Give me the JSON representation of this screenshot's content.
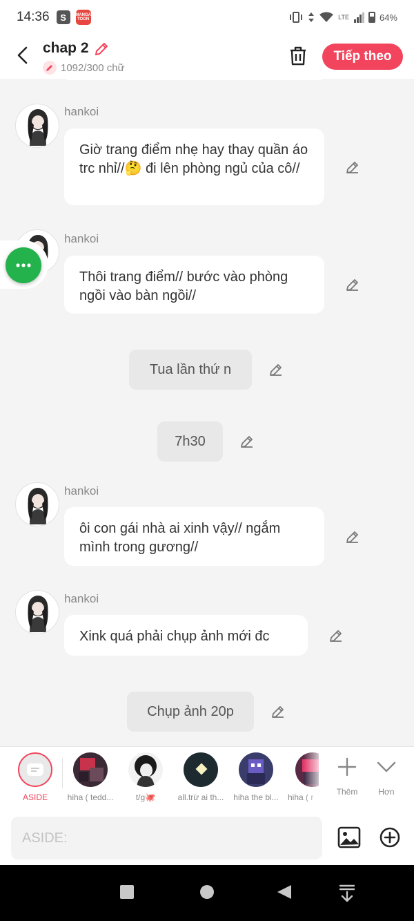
{
  "status_bar": {
    "time": "14:36",
    "s_badge": "S",
    "app_badge": "MANGA TOON",
    "network": "LTE",
    "battery": "64%"
  },
  "header": {
    "title": "chap 2",
    "word_count": "1092/300 chữ",
    "next_label": "Tiếp theo"
  },
  "messages": [
    {
      "type": "dialogue",
      "author": "hankoi",
      "text": "Giờ trang điểm nhẹ hay thay quần áo trc nhỉ//🤔 đi lên phòng ngủ của cô//"
    },
    {
      "type": "dialogue",
      "author": "hankoi",
      "text": "Thôi trang điểm// bước vào phòng ngồi vào bàn ngồi//"
    },
    {
      "type": "narration",
      "text": "Tua lần thứ n"
    },
    {
      "type": "narration",
      "text": "7h30"
    },
    {
      "type": "dialogue",
      "author": "hankoi",
      "text": "ôi con gái nhà ai xinh vậy// ngắm mình trong gương//"
    },
    {
      "type": "dialogue",
      "author": "hankoi",
      "text": "Xink quá phải chụp ảnh mới đc"
    },
    {
      "type": "narration",
      "text": "Chụp ảnh 20p"
    }
  ],
  "characters": [
    {
      "name": "ASIDE",
      "active": true
    },
    {
      "name": "hiha ( tedd..."
    },
    {
      "name": "t/g🐙"
    },
    {
      "name": "all.trừ ai th..."
    },
    {
      "name": "hiha the bl..."
    },
    {
      "name": "hiha ( r"
    }
  ],
  "actions": {
    "add_label": "Thêm",
    "more_label": "Hơn"
  },
  "input": {
    "placeholder": "ASIDE:"
  },
  "colors": {
    "accent": "#f2455d",
    "fab": "#24b24c",
    "background": "#f4f4f4"
  }
}
